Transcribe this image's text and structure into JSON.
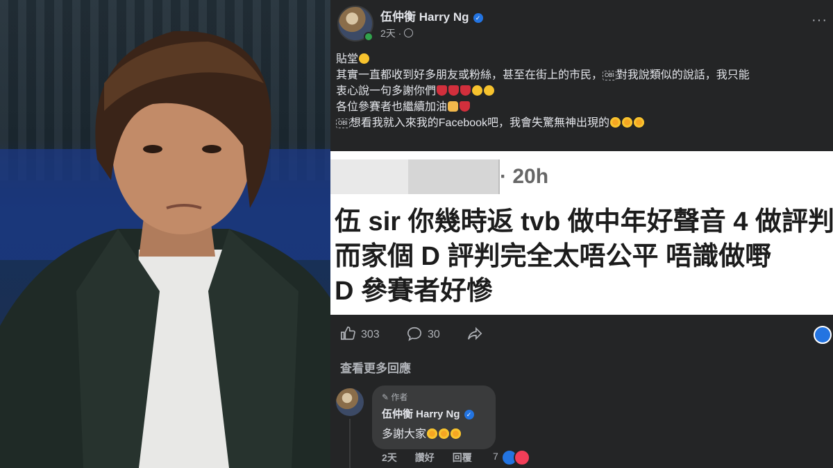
{
  "photo": {
    "alt_subject": "man-portrait"
  },
  "post": {
    "author": "伍仲衡 Harry Ng",
    "time": "2天",
    "lines": [
      "貼堂",
      "其實一直都收到好多朋友或粉絲，甚至在街上的市民，",
      "對我說類似的說話，我只能",
      "衷心說一句多謝你們",
      "各位參賽者也繼續加油",
      "想看我就入來我的Facebook吧，我會失驚無神出現的"
    ],
    "obi_label": "OBI"
  },
  "screenshot": {
    "time": "· 20h",
    "lines": [
      "伍 sir 你幾時返 tvb 做中年好聲音 4 做評判",
      "而家個 D 評判完全太唔公平  唔識做嘢",
      "D 參賽者好慘"
    ]
  },
  "actions": {
    "likes": "303",
    "comments": "30"
  },
  "view_more": "查看更多回應",
  "reply": {
    "badge": "作者",
    "name": "伍仲衡 Harry Ng",
    "text": "多謝大家",
    "time": "2天",
    "like_label": "讚好",
    "reply_label": "回覆",
    "reaction_count": "7"
  },
  "colors": {
    "accent": "#2374e1",
    "panel_bg": "#242526",
    "love": "#f33e58"
  }
}
